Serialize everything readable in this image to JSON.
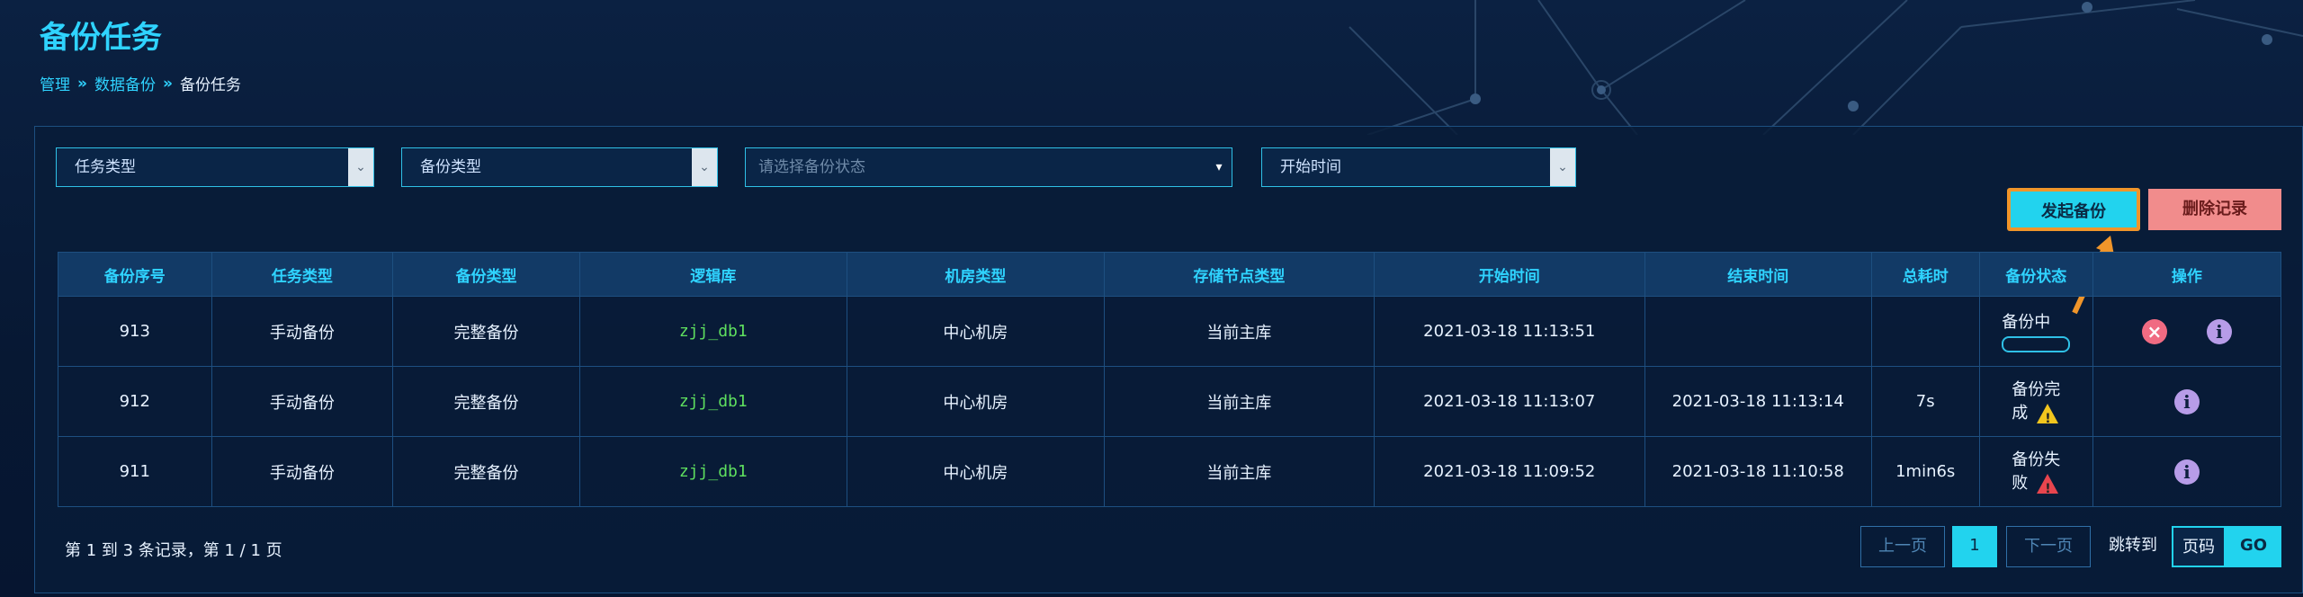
{
  "page": {
    "title": "备份任务"
  },
  "breadcrumb": {
    "item1": "管理",
    "sep1": "»",
    "item2": "数据备份",
    "sep2": "»",
    "item3": "备份任务"
  },
  "filters": {
    "task_type": "任务类型",
    "backup_type": "备份类型",
    "backup_status_placeholder": "请选择备份状态",
    "start_time": "开始时间"
  },
  "actions": {
    "start_backup": "发起备份",
    "delete_records": "删除记录"
  },
  "table": {
    "headers": [
      "备份序号",
      "任务类型",
      "备份类型",
      "逻辑库",
      "机房类型",
      "存储节点类型",
      "开始时间",
      "结束时间",
      "总耗时",
      "备份状态",
      "操作"
    ],
    "rows": [
      {
        "id": "913",
        "task_type": "手动备份",
        "backup_type": "完整备份",
        "db": "zjj_db1",
        "room": "中心机房",
        "node": "当前主库",
        "start": "2021-03-18 11:13:51",
        "end": "",
        "duration": "",
        "status": "备份中"
      },
      {
        "id": "912",
        "task_type": "手动备份",
        "backup_type": "完整备份",
        "db": "zjj_db1",
        "room": "中心机房",
        "node": "当前主库",
        "start": "2021-03-18 11:13:07",
        "end": "2021-03-18 11:13:14",
        "duration": "7s",
        "status_line1": "备份完",
        "status_line2": "成"
      },
      {
        "id": "911",
        "task_type": "手动备份",
        "backup_type": "完整备份",
        "db": "zjj_db1",
        "room": "中心机房",
        "node": "当前主库",
        "start": "2021-03-18 11:09:52",
        "end": "2021-03-18 11:10:58",
        "duration": "1min6s",
        "status_line1": "备份失",
        "status_line2": "败"
      }
    ]
  },
  "icons": {
    "cancel": "×",
    "info": "i",
    "warning": "!"
  },
  "footer": {
    "summary": "第 1 到 3 条记录，第 1 / 1 页",
    "prev": "上一页",
    "current_page": "1",
    "next": "下一页",
    "jump_label": "跳转到",
    "page_input_placeholder": "页码",
    "go": "GO"
  },
  "colors": {
    "accent": "#22d3ee",
    "highlight_border": "#f0952a",
    "danger_button": "#f18c8c"
  }
}
